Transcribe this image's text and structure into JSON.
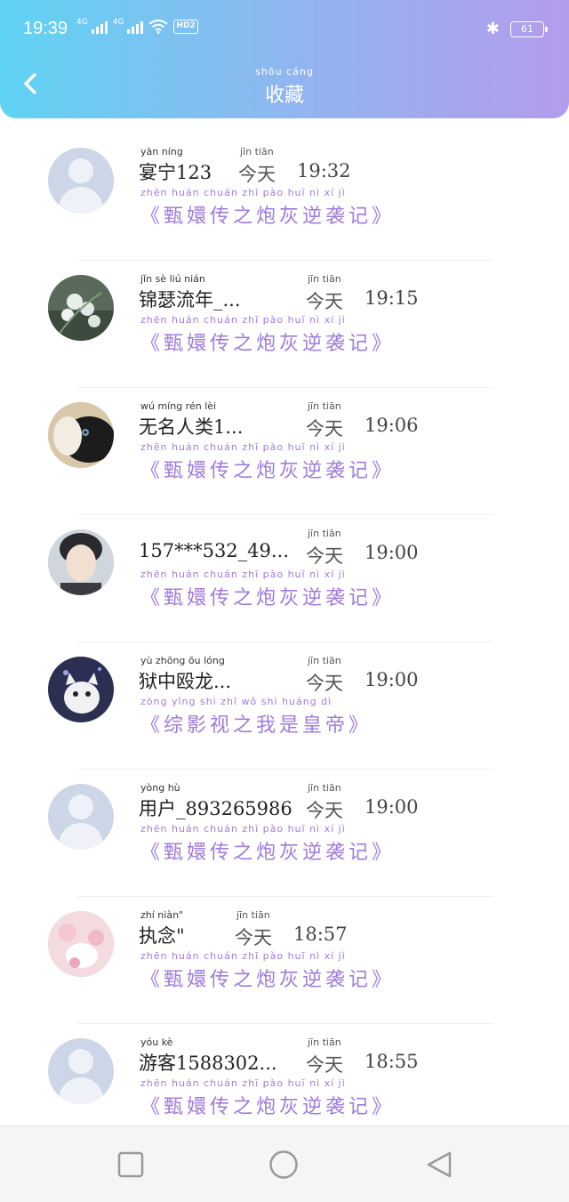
{
  "status_bar": {
    "time": "19:39",
    "network_1": "4G",
    "network_2": "4G",
    "hd": "HD2",
    "battery": "61"
  },
  "header": {
    "title_pinyin": "shōu cáng",
    "title": "收藏"
  },
  "items": [
    {
      "name_pinyin": "yàn níng",
      "name": "宴宁123",
      "today_pinyin": "jīn tiān",
      "today": "今天",
      "time": "19:32",
      "book_pinyin": "zhēn huán chuán zhī pào huī nì xí jì",
      "book": "《甄嬛传之炮灰逆袭记》",
      "avatar": "default"
    },
    {
      "name_pinyin": "jǐn sè liú nián",
      "name": "锦瑟流年_...",
      "today_pinyin": "jīn tiān",
      "today": "今天",
      "time": "19:15",
      "book_pinyin": "zhēn huán chuán zhī pào huī nì xí jì",
      "book": "《甄嬛传之炮灰逆袭记》",
      "avatar": "flower"
    },
    {
      "name_pinyin": "wú míng rén lèi",
      "name": "无名人类1...",
      "today_pinyin": "jīn tiān",
      "today": "今天",
      "time": "19:06",
      "book_pinyin": "zhēn huán chuán zhī pào huī nì xí jì",
      "book": "《甄嬛传之炮灰逆袭记》",
      "avatar": "cat"
    },
    {
      "name_pinyin": "",
      "name": "157***532_49...",
      "today_pinyin": "jīn tiān",
      "today": "今天",
      "time": "19:00",
      "book_pinyin": "zhēn huán chuán zhī pào huī nì xí jì",
      "book": "《甄嬛传之炮灰逆袭记》",
      "avatar": "person"
    },
    {
      "name_pinyin": "yù zhōng ōu lóng",
      "name": "狱中殴龙...",
      "today_pinyin": "jīn tiān",
      "today": "今天",
      "time": "19:00",
      "book_pinyin": "zōng yǐng shì zhī wǒ shì huáng dì",
      "book": "《综影视之我是皇帝》",
      "avatar": "kitten"
    },
    {
      "name_pinyin": "yòng hù",
      "name": "用户_893265986",
      "today_pinyin": "jīn tiān",
      "today": "今天",
      "time": "19:00",
      "book_pinyin": "zhēn huán chuán zhī pào huī nì xí jì",
      "book": "《甄嬛传之炮灰逆袭记》",
      "avatar": "default"
    },
    {
      "name_pinyin": "zhí niàn\"",
      "name": "执念\"",
      "today_pinyin": "jīn tiān",
      "today": "今天",
      "time": "18:57",
      "book_pinyin": "zhēn huán chuán zhī pào huī nì xí jì",
      "book": "《甄嬛传之炮灰逆袭记》",
      "avatar": "pink"
    },
    {
      "name_pinyin": "yóu kè",
      "name": "游客1588302...",
      "today_pinyin": "jīn tiān",
      "today": "今天",
      "time": "18:55",
      "book_pinyin": "zhēn huán chuán zhī pào huī nì xí jì",
      "book": "《甄嬛传之炮灰逆袭记》",
      "avatar": "default"
    }
  ],
  "colors": {
    "header_start": "#5fd3f3",
    "header_end": "#b39cec",
    "book_title": "#a07be0"
  }
}
